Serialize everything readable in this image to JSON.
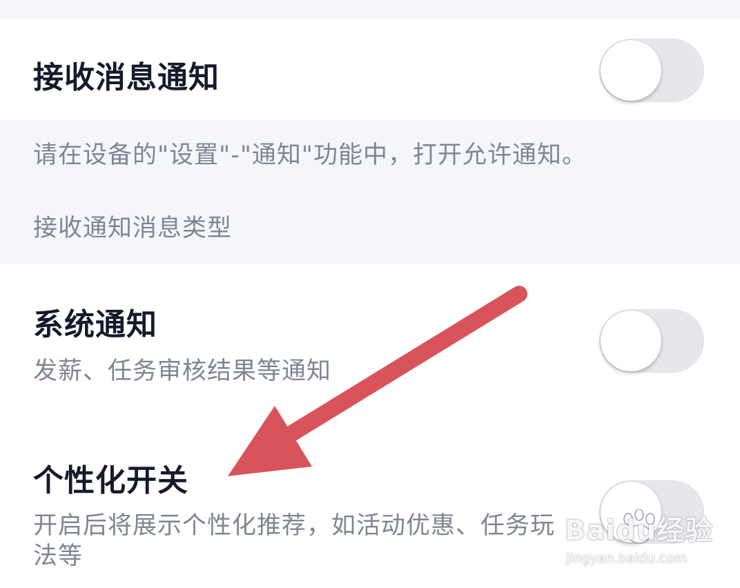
{
  "receive_notifications": {
    "title": "接收消息通知",
    "toggle_on": false
  },
  "info_panel": {
    "hint": "请在设备的\"设置\"-\"通知\"功能中，打开允许通知。",
    "section_header": "接收通知消息类型"
  },
  "system_notifications": {
    "title": "系统通知",
    "description": "发薪、任务审核结果等通知",
    "toggle_on": false
  },
  "personalization": {
    "title": "个性化开关",
    "description": "开启后将展示个性化推荐，如活动优惠、任务玩法等",
    "toggle_on": false
  },
  "annotation": {
    "arrow_color": "#d9545a"
  },
  "watermark": {
    "logo": "Baidu经验",
    "url": "jingyan.baidu.com"
  }
}
